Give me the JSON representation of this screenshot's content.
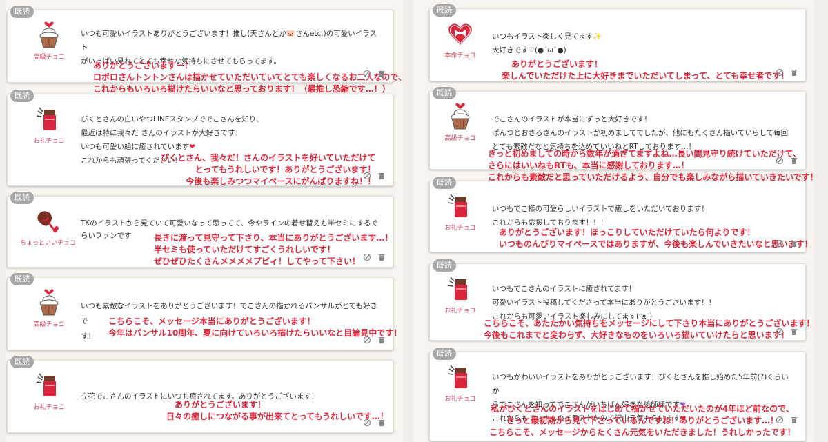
{
  "read_label": "既読",
  "left_cards": [
    {
      "stamp_name": "高級チョコ",
      "message": [
        "いつも可愛いイラストありがとうございます！推し(天さんとか🐷さんetc.)の可愛いイラスト",
        "がいっぱい見れてとても幸せな気持ちにさせてもらってます。"
      ],
      "reply": [
        "ありがとうございますー！",
        "ロボロさんトントンさんは描かせていただいていてとても楽しくなるお二人なので、",
        "これからもいろいろ描けたらいいなと思っております！（最推し恐縮です…！）"
      ]
    },
    {
      "stamp_name": "お礼チョコ",
      "message": [
        "ぴくとさんの白いやつLINEスタンプででこさんを知り、",
        "最近は特に我々だ さんのイラストが大好きです！",
        "いつも可愛い絵に癒されています",
        "これからも頑張ってください！"
      ],
      "reply": [
        "ぴくとさん、我々だ！さんのイラストを好いていただけて",
        "とってもうれしいです！ありがとうございます！",
        "今後も楽しみつつマイペースにがんばりますね！！"
      ]
    },
    {
      "stamp_name": "ちょっといいチョコ",
      "message": [
        "TKのイラストから見ていて可愛いなって思ってて、今やラインの着せ替えも半セミにするぐ",
        "らいファンです"
      ],
      "reply": [
        "長きに渡って見守って下さり、本当にありがとうございます…！",
        "半セミも使っていただけてすごくうれしいです！",
        "ぜひぜひたくさんメメメメプピィ！してやって下さい！"
      ]
    },
    {
      "stamp_name": "高級チョコ",
      "message": [
        "いつも素敵なイラストをありがとうございます！でこさんの描かれるパンサルがとても好きで",
        "す！"
      ],
      "reply": [
        "こちらこそ、メッセージ本当にありがとうございます！",
        "今年はパンサル10周年、夏に向けていろいろ描けたらいいなと目論見中です！"
      ]
    },
    {
      "stamp_name": "お礼チョコ",
      "message": [
        "立花でこさんのイラストにいつも癒されてます。ありがとうございます！"
      ],
      "reply": [
        "ありがとうございます！",
        "日々の癒しにつながる事が出来てとってもうれしいです…！"
      ]
    }
  ],
  "right_cards": [
    {
      "stamp_name": "本命チョコ",
      "message": [
        "いつもイラスト楽しく見てます✨",
        "大好きです♡(●´ω`●)"
      ],
      "reply": [
        "ありがとうございます！",
        "楽しんでいただけた上に大好きまでいただいてしまって、とても幸せ者です！"
      ]
    },
    {
      "stamp_name": "高級チョコ",
      "message": [
        "でこさんのイラストが本当にずっと大好きです！",
        "ぱんつとおさるさんのイラストが初めましてでしたが、他にもたくさん描いていらして毎回",
        "とても素敵だなと気持ちを込めていいねとRTしております…！"
      ],
      "reply": [
        "きっと初めましての時から数年が過ぎてますよね…長い間見守り続けていただけて、",
        "さらにはいいねもRTも、本当に感謝しております…！",
        "これからも素敵だと思っていただけるよう、自分でも楽しみながら描いていきたいです！"
      ]
    },
    {
      "stamp_name": "お礼チョコ",
      "message": [
        "いつもでこ様の可愛らしいイラストで癒しをいただいております！",
        "これからも応援しております！！！"
      ],
      "reply": [
        "ありがとうございます！ほっこりしていただけていたら何よりです！",
        "いつものんびりマイペースではありますが、今後も楽しんでいきたいなと思います！"
      ]
    },
    {
      "stamp_name": "お礼チョコ",
      "message": [
        "いつもでこさんのイラストに癒されてます！",
        "可愛いイラスト投稿してくださって本当にありがとうございます！！",
        "これからも可愛いイラスト楽しみにしてます(ᵔᴥᵔ)"
      ],
      "reply": [
        "こちらこそ、あたたかい気持ちをメッセージにして下さり本当にありがとうございます！",
        "今後もこれまでと変わらず、大好きなものをいろいろ描いていけたらと思います！"
      ]
    },
    {
      "stamp_name": "お礼チョコ",
      "message": [
        "いつもかわいいイラストをありがとうございます！ぴくとさんを推し始めた5年前(?)くらいか",
        "らでこさんを知ってでこさんがいちばん好きな絵師様です",
        "これからもでこさんのイラストをみて沢山元気もらいます"
      ],
      "reply": [
        "私がぴくとさんのイラストをはじめて描かせていただいたのが4年ほど前なので、",
        "きっと最初期から見て下さっているんですね！ありがとうございます…！",
        "こちらこそ、メッセージからたくさん元気をいただきました！うれしかったです！"
      ]
    }
  ]
}
